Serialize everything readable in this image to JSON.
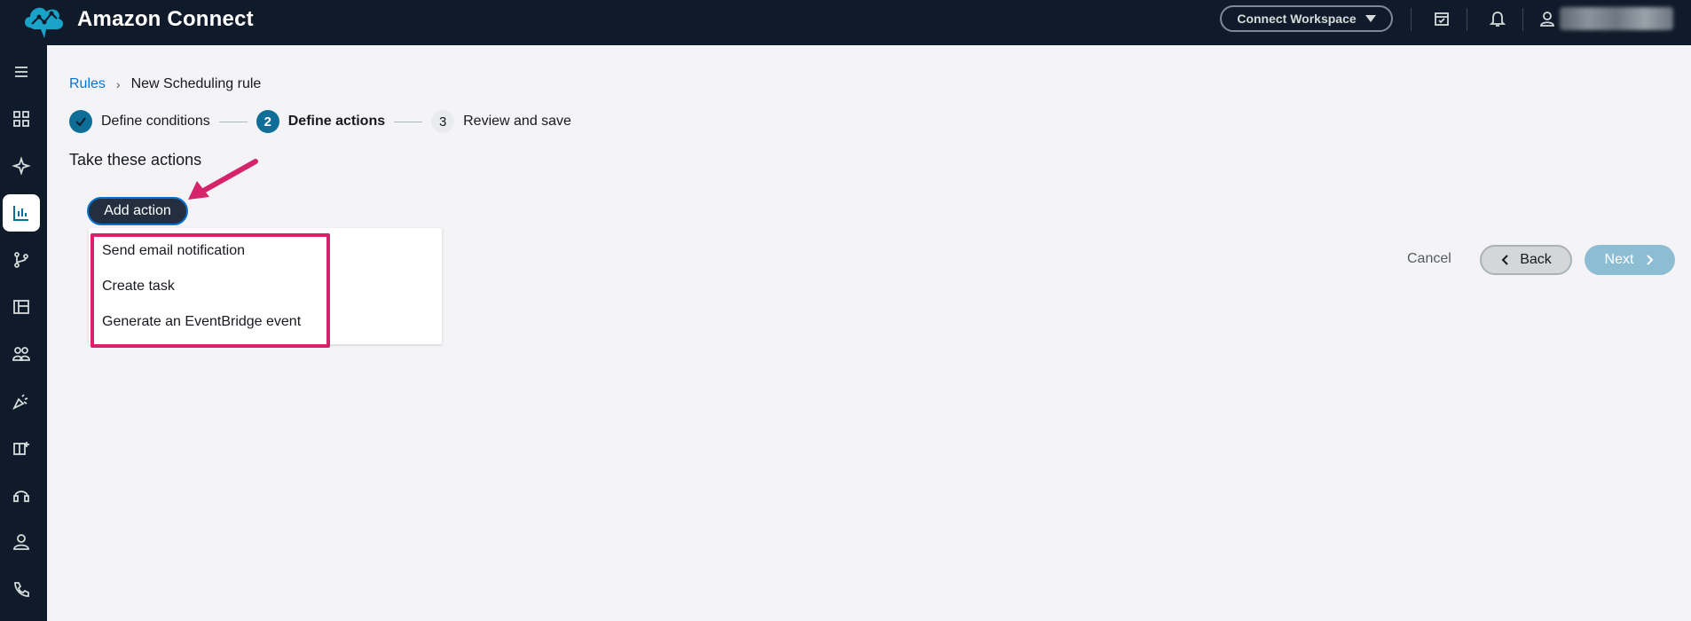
{
  "header": {
    "app_title": "Amazon Connect",
    "workspace_label": "Connect Workspace",
    "icons": [
      "calendar-check-icon",
      "bell-icon",
      "user-icon"
    ]
  },
  "sidebar": {
    "items": [
      {
        "icon": "menu-icon",
        "active": false
      },
      {
        "icon": "dashboard-icon",
        "active": false
      },
      {
        "icon": "sparkle-icon",
        "active": false
      },
      {
        "icon": "analytics-icon",
        "active": true
      },
      {
        "icon": "routing-icon",
        "active": false
      },
      {
        "icon": "layout-icon",
        "active": false
      },
      {
        "icon": "users-icon",
        "active": false
      },
      {
        "icon": "campaign-icon",
        "active": false
      },
      {
        "icon": "channels-icon",
        "active": false
      },
      {
        "icon": "headset-icon",
        "active": false
      },
      {
        "icon": "user-icon",
        "active": false
      },
      {
        "icon": "phone-icon",
        "active": false
      }
    ]
  },
  "breadcrumb": {
    "root": "Rules",
    "current": "New Scheduling rule"
  },
  "steps": [
    {
      "number": "",
      "label": "Define conditions",
      "state": "done"
    },
    {
      "number": "2",
      "label": "Define actions",
      "state": "current"
    },
    {
      "number": "3",
      "label": "Review and save",
      "state": "pending"
    }
  ],
  "main": {
    "section_title": "Take these actions",
    "add_action_label": "Add action",
    "menu_items": [
      "Send email notification",
      "Create task",
      "Generate an EventBridge event"
    ]
  },
  "footer": {
    "cancel_label": "Cancel",
    "back_label": "Back",
    "next_label": "Next"
  },
  "colors": {
    "topbar": "#0f1b2a",
    "accent": "#0f6e98",
    "highlight": "#d6246c",
    "link": "#0972d3"
  }
}
